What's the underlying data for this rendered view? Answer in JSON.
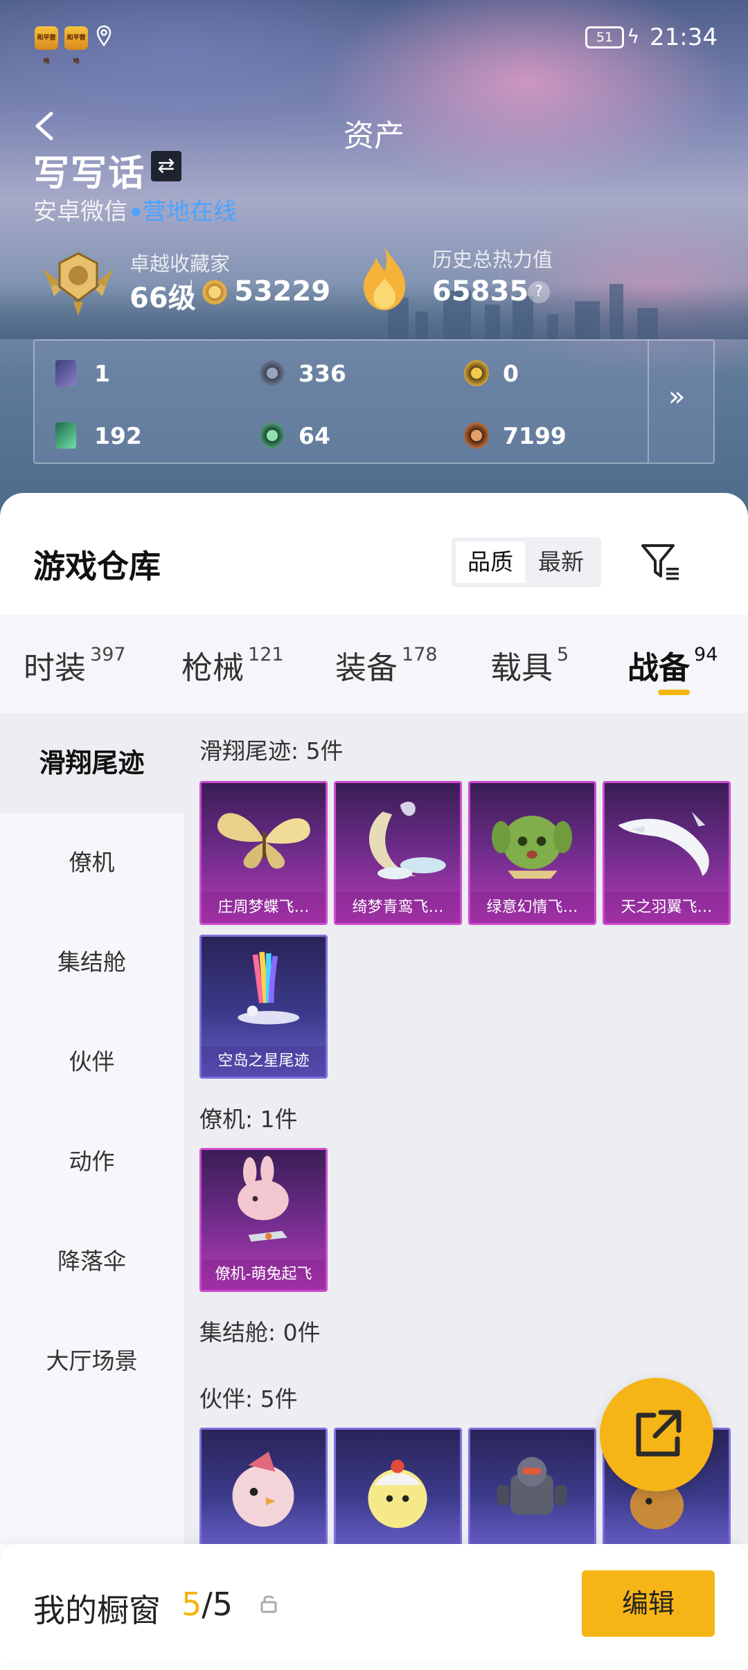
{
  "status_bar": {
    "time": "21:34",
    "battery": "51",
    "app_icon_text": "和平营地"
  },
  "header": {
    "title": "资产",
    "username": "写写话",
    "swap_icon": "⇄",
    "platform": "安卓微信",
    "online_status": "营地在线"
  },
  "stats": {
    "collector_title": "卓越收藏家",
    "level": "66级",
    "collector_points": "53229",
    "heat_title": "历史总热力值",
    "heat_value": "65835",
    "help": "?"
  },
  "currencies": [
    {
      "icon": "card-icon",
      "value": "1"
    },
    {
      "icon": "silver-coin-icon",
      "value": "336"
    },
    {
      "icon": "gold-coin-icon",
      "value": "0"
    },
    {
      "icon": "ticket-icon",
      "value": "192"
    },
    {
      "icon": "green-coin-icon",
      "value": "64"
    },
    {
      "icon": "bronze-coin-icon",
      "value": "7199"
    }
  ],
  "currency_more": "»",
  "warehouse": {
    "title": "游戏仓库",
    "sort_options": [
      "品质",
      "最新"
    ],
    "sort_selected": "品质"
  },
  "tabs": [
    {
      "label": "时装",
      "count": "397"
    },
    {
      "label": "枪械",
      "count": "121"
    },
    {
      "label": "装备",
      "count": "178"
    },
    {
      "label": "载具",
      "count": "5"
    },
    {
      "label": "战备",
      "count": "94",
      "active": true
    }
  ],
  "categories": [
    "滑翔尾迹",
    "僚机",
    "集结舱",
    "伙伴",
    "动作",
    "降落伞",
    "大厅场景"
  ],
  "active_category": "滑翔尾迹",
  "sections": [
    {
      "label": "滑翔尾迹: 5件",
      "items": [
        "庄周梦蝶飞…",
        "绮梦青鸾飞…",
        "绿意幻情飞…",
        "天之羽翼飞…",
        "空岛之星尾迹"
      ]
    },
    {
      "label": "僚机: 1件",
      "items": [
        "僚机-萌兔起飞"
      ]
    },
    {
      "label": "集结舱: 0件",
      "items": []
    },
    {
      "label": "伙伴: 5件",
      "items": []
    }
  ],
  "showcase": {
    "label": "我的橱窗",
    "current": "5",
    "total": "/5",
    "edit": "编辑"
  },
  "colors": {
    "accent": "#f6b516",
    "online": "#4aa3ff",
    "legendary": "#cf4ad0",
    "epic": "#7f6fe0"
  }
}
